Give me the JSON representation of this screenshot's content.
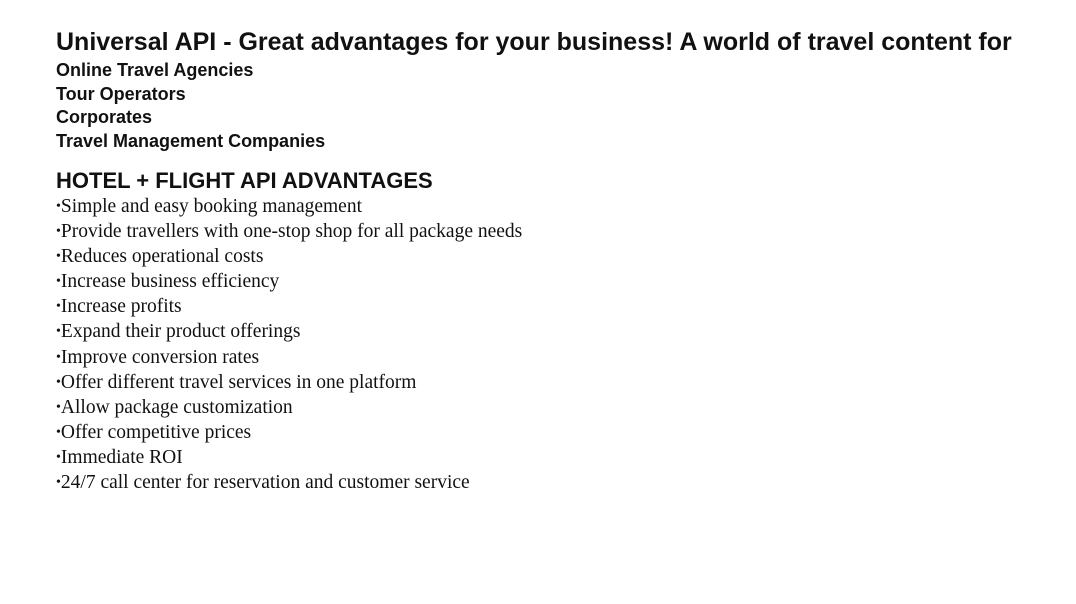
{
  "document": {
    "title": "Universal API - Great advantages for your business! A world of travel content for",
    "audience": [
      "Online Travel Agencies",
      "Tour Operators",
      "Corporates",
      "Travel Management Companies"
    ],
    "section_heading": "HOTEL + FLIGHT API ADVANTAGES",
    "bullet_glyph": "•",
    "advantages": [
      "Simple and easy booking management",
      "Provide travellers with one-stop shop for all package needs",
      "Reduces operational costs",
      "Increase business efficiency",
      "Increase profits",
      "Expand their product offerings",
      "Improve conversion rates",
      "Offer different travel services in one platform",
      "Allow package customization",
      "Offer competitive prices",
      "Immediate ROI",
      "24/7 call center for reservation and customer service"
    ]
  },
  "colors": {
    "background": "#ffffff",
    "text": "#111111"
  }
}
